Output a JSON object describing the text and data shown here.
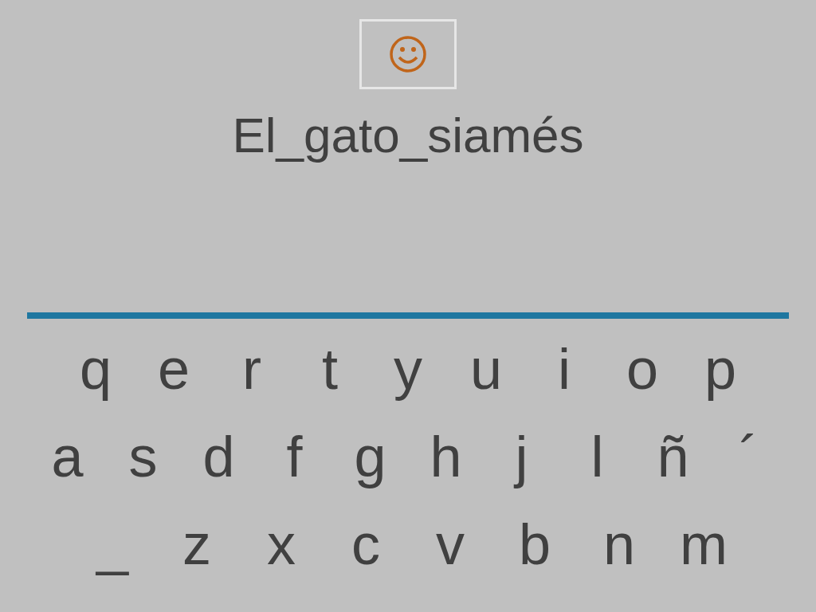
{
  "phrase": "El_gato_siamés",
  "keyboard": {
    "rows": [
      [
        "q",
        "e",
        "r",
        "t",
        "y",
        "u",
        "i",
        "o",
        "p"
      ],
      [
        "a",
        "s",
        "d",
        "f",
        "g",
        "h",
        "j",
        "l",
        "ñ",
        "´"
      ],
      [
        "_",
        "z",
        "x",
        "c",
        "v",
        "b",
        "n",
        "m"
      ]
    ]
  }
}
